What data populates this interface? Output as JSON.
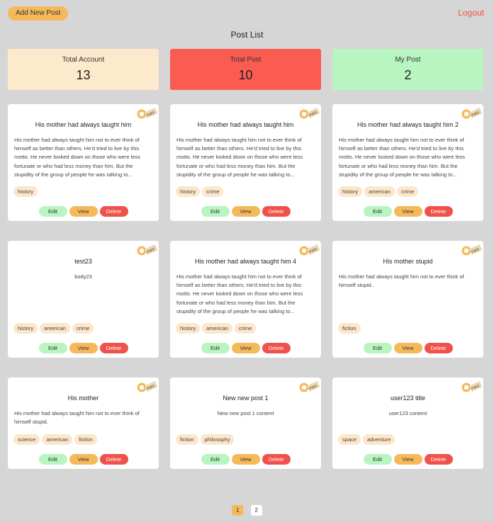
{
  "header": {
    "add_label": "Add New Post",
    "logout_label": "Logout",
    "page_title": "Post List"
  },
  "stats": [
    {
      "label": "Total Account",
      "value": "13",
      "color": "#fde9cb"
    },
    {
      "label": "Total Post",
      "value": "10",
      "color": "#fb5c52"
    },
    {
      "label": "My Post",
      "value": "2",
      "color": "#b8f5c0"
    }
  ],
  "badge_text": "PWG",
  "actions": {
    "edit": "Edit",
    "view": "View",
    "delete": "Delete"
  },
  "posts": [
    {
      "title": "His mother had always taught him",
      "body": "His mother had always taught him not to ever think of himself as better than others. He'd tried to live by this motto. He never looked down on those who were less fortunate or who had less money than him. But the stupidity of the group of people he was talking to...",
      "tags": [
        "history"
      ]
    },
    {
      "title": "His mother had always taught him",
      "body": "His mother had always taught him not to ever think of himself as better than others. He'd tried to live by this motto. He never looked down on those who were less fortunate or who had less money than him. But the stupidity of the group of people he was talking to...",
      "tags": [
        "history",
        "crime"
      ]
    },
    {
      "title": "His mother had always taught him 2",
      "body": "His mother had always taught him not to ever think of himself as better than others. He'd tried to live by this motto. He never looked down on those who were less fortunate or who had less money than him. But the stupidity of the group of people he was talking to...",
      "tags": [
        "history",
        "american",
        "crime"
      ]
    },
    {
      "title": "test23",
      "body": "body23",
      "tags": [
        "history",
        "american",
        "crime"
      ]
    },
    {
      "title": "His mother had always taught him 4",
      "body": "His mother had always taught him not to ever think of himself as better than others. He'd tried to live by this motto. He never looked down on those who were less fortunate or who had less money than him. But the stupidity of the group of people he was talking to...",
      "tags": [
        "history",
        "american",
        "crime"
      ]
    },
    {
      "title": "His mother stupid",
      "body": "His mother had always taught him not to ever think of himself stupid..",
      "tags": [
        "fiction"
      ]
    },
    {
      "title": "His mother",
      "body": "His mother had always taught him not to ever think of himself stupid.",
      "tags": [
        "science",
        "american",
        "fiction"
      ]
    },
    {
      "title": "New new post 1",
      "body": "New new post 1 content",
      "tags": [
        "fiction",
        "philosophy"
      ]
    },
    {
      "title": "user123 title",
      "body": "user123 content",
      "tags": [
        "space",
        "adventure"
      ]
    }
  ],
  "pagination": [
    "1",
    "2"
  ]
}
